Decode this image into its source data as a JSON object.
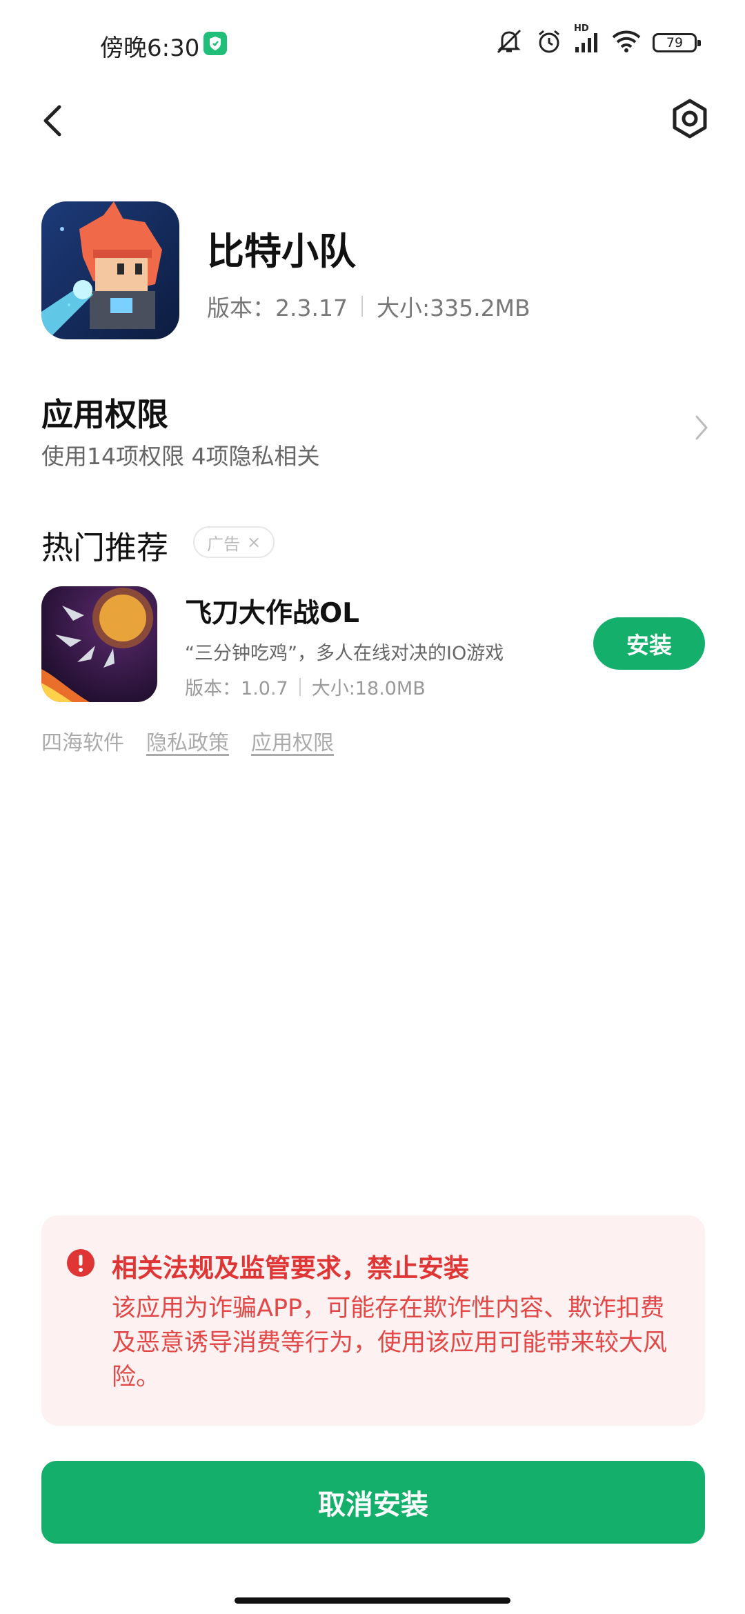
{
  "status_bar": {
    "time": "傍晚6:30",
    "battery": "79",
    "network_label": "HD",
    "icons": [
      "shield-icon",
      "mute-icon",
      "alarm-icon",
      "signal-icon",
      "wifi-icon",
      "battery-icon"
    ]
  },
  "header": {
    "back_icon": "back-arrow-icon",
    "settings_icon": "settings-icon"
  },
  "app": {
    "name": "比特小队",
    "version": "版本：2.3.17",
    "size": "大小:335.2MB"
  },
  "permissions": {
    "title": "应用权限",
    "summary": "使用14项权限 4项隐私相关"
  },
  "recommendations": {
    "title": "热门推荐",
    "ad_label": "广告",
    "ad_close": "×",
    "items": [
      {
        "name": "飞刀大作战OL",
        "description": "“三分钟吃鸡”，多人在线对决的IO游戏",
        "version": "版本：1.0.7",
        "size": "大小:18.0MB",
        "install_label": "安装"
      }
    ]
  },
  "developer_links": {
    "developer": "四海软件",
    "privacy": "隐私政策",
    "permissions": "应用权限"
  },
  "warning": {
    "title": "相关法规及监管要求，禁止安装",
    "body": "该应用为诈骗APP，可能存在欺诈性内容、欺诈扣费及恶意诱导消费等行为，使用该应用可能带来较大风险。"
  },
  "actions": {
    "cancel_label": "取消安装"
  },
  "colors": {
    "accent_green": "#14b06b",
    "warning_red": "#e03535",
    "warning_bg": "#fdf1f1"
  }
}
